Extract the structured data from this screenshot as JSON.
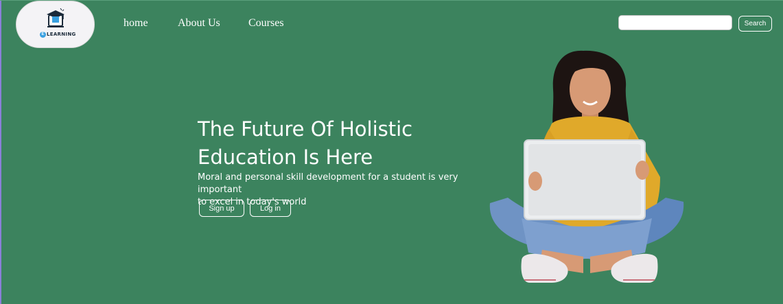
{
  "logo": {
    "text": "LEARNING",
    "letter": "E",
    "icon": "graduation-cap-laptop-icon"
  },
  "nav": {
    "home": "home",
    "about": "About Us",
    "courses": "Courses"
  },
  "search": {
    "value": "",
    "placeholder": "",
    "button_label": "Search"
  },
  "hero": {
    "title_line1": "The Future Of Holistic",
    "title_line2": "Education Is Here",
    "subtitle_line1": "Moral and personal skill development for a student is very important",
    "subtitle_line2": "to excel in today's world",
    "signup_label": "Sign up",
    "login_label": "Log in",
    "illustration": "woman-with-laptop-illustration"
  },
  "colors": {
    "background": "#3c835e",
    "text": "#ffffff",
    "logo_bg": "#f4f3f6"
  }
}
